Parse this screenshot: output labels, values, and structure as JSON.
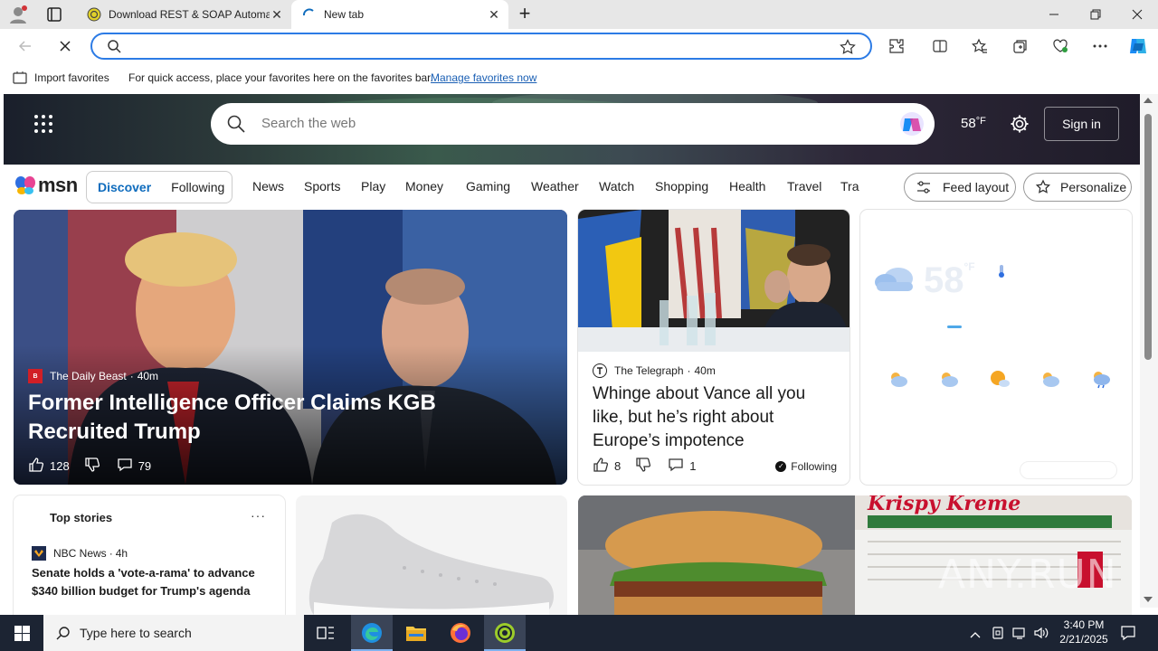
{
  "browser": {
    "tabs": [
      {
        "title": "Download REST & SOAP Automa"
      },
      {
        "title": "New tab"
      }
    ],
    "favorites_bar": {
      "import_label": "Import favorites",
      "hint": "For quick access, place your favorites here on the favorites bar.",
      "manage_link": "Manage favorites now"
    }
  },
  "msn": {
    "search_placeholder": "Search the web",
    "temperature": "58",
    "temp_unit": "°F",
    "sign_in": "Sign in",
    "logo_text": "msn",
    "segment": [
      "Discover",
      "Following"
    ],
    "nav": [
      "News",
      "Sports",
      "Play",
      "Money",
      "Gaming",
      "Weather",
      "Watch",
      "Shopping",
      "Health",
      "Travel",
      "Tra"
    ],
    "feed_layout": "Feed layout",
    "personalize": "Personalize"
  },
  "hero_story": {
    "source": "The Daily Beast",
    "age": "40m",
    "title": "Former Intelligence Officer Claims KGB Recruited Trump",
    "likes": "128",
    "comments": "79"
  },
  "story2": {
    "source": "The Telegraph",
    "age": "40m",
    "title": "Whinge about Vance all you like, but he’s right about Europe’s impotence",
    "likes": "8",
    "comments": "1",
    "following": "Following"
  },
  "weather_card": {
    "temp": "58",
    "unit": "°F"
  },
  "top_stories": {
    "heading": "Top stories",
    "source": "NBC News",
    "age": "4h",
    "headline": "Senate holds a 'vote-a-rama' to advance $340 billion budget for Trump's agenda"
  },
  "taskbar": {
    "search_placeholder": "Type here to search",
    "time": "3:40 PM",
    "date": "2/21/2025"
  },
  "watermark": "ANY.RUN",
  "colors": {
    "accent": "#0f6cbd",
    "taskbar": "#1c2433",
    "link": "#1a5fb4"
  }
}
